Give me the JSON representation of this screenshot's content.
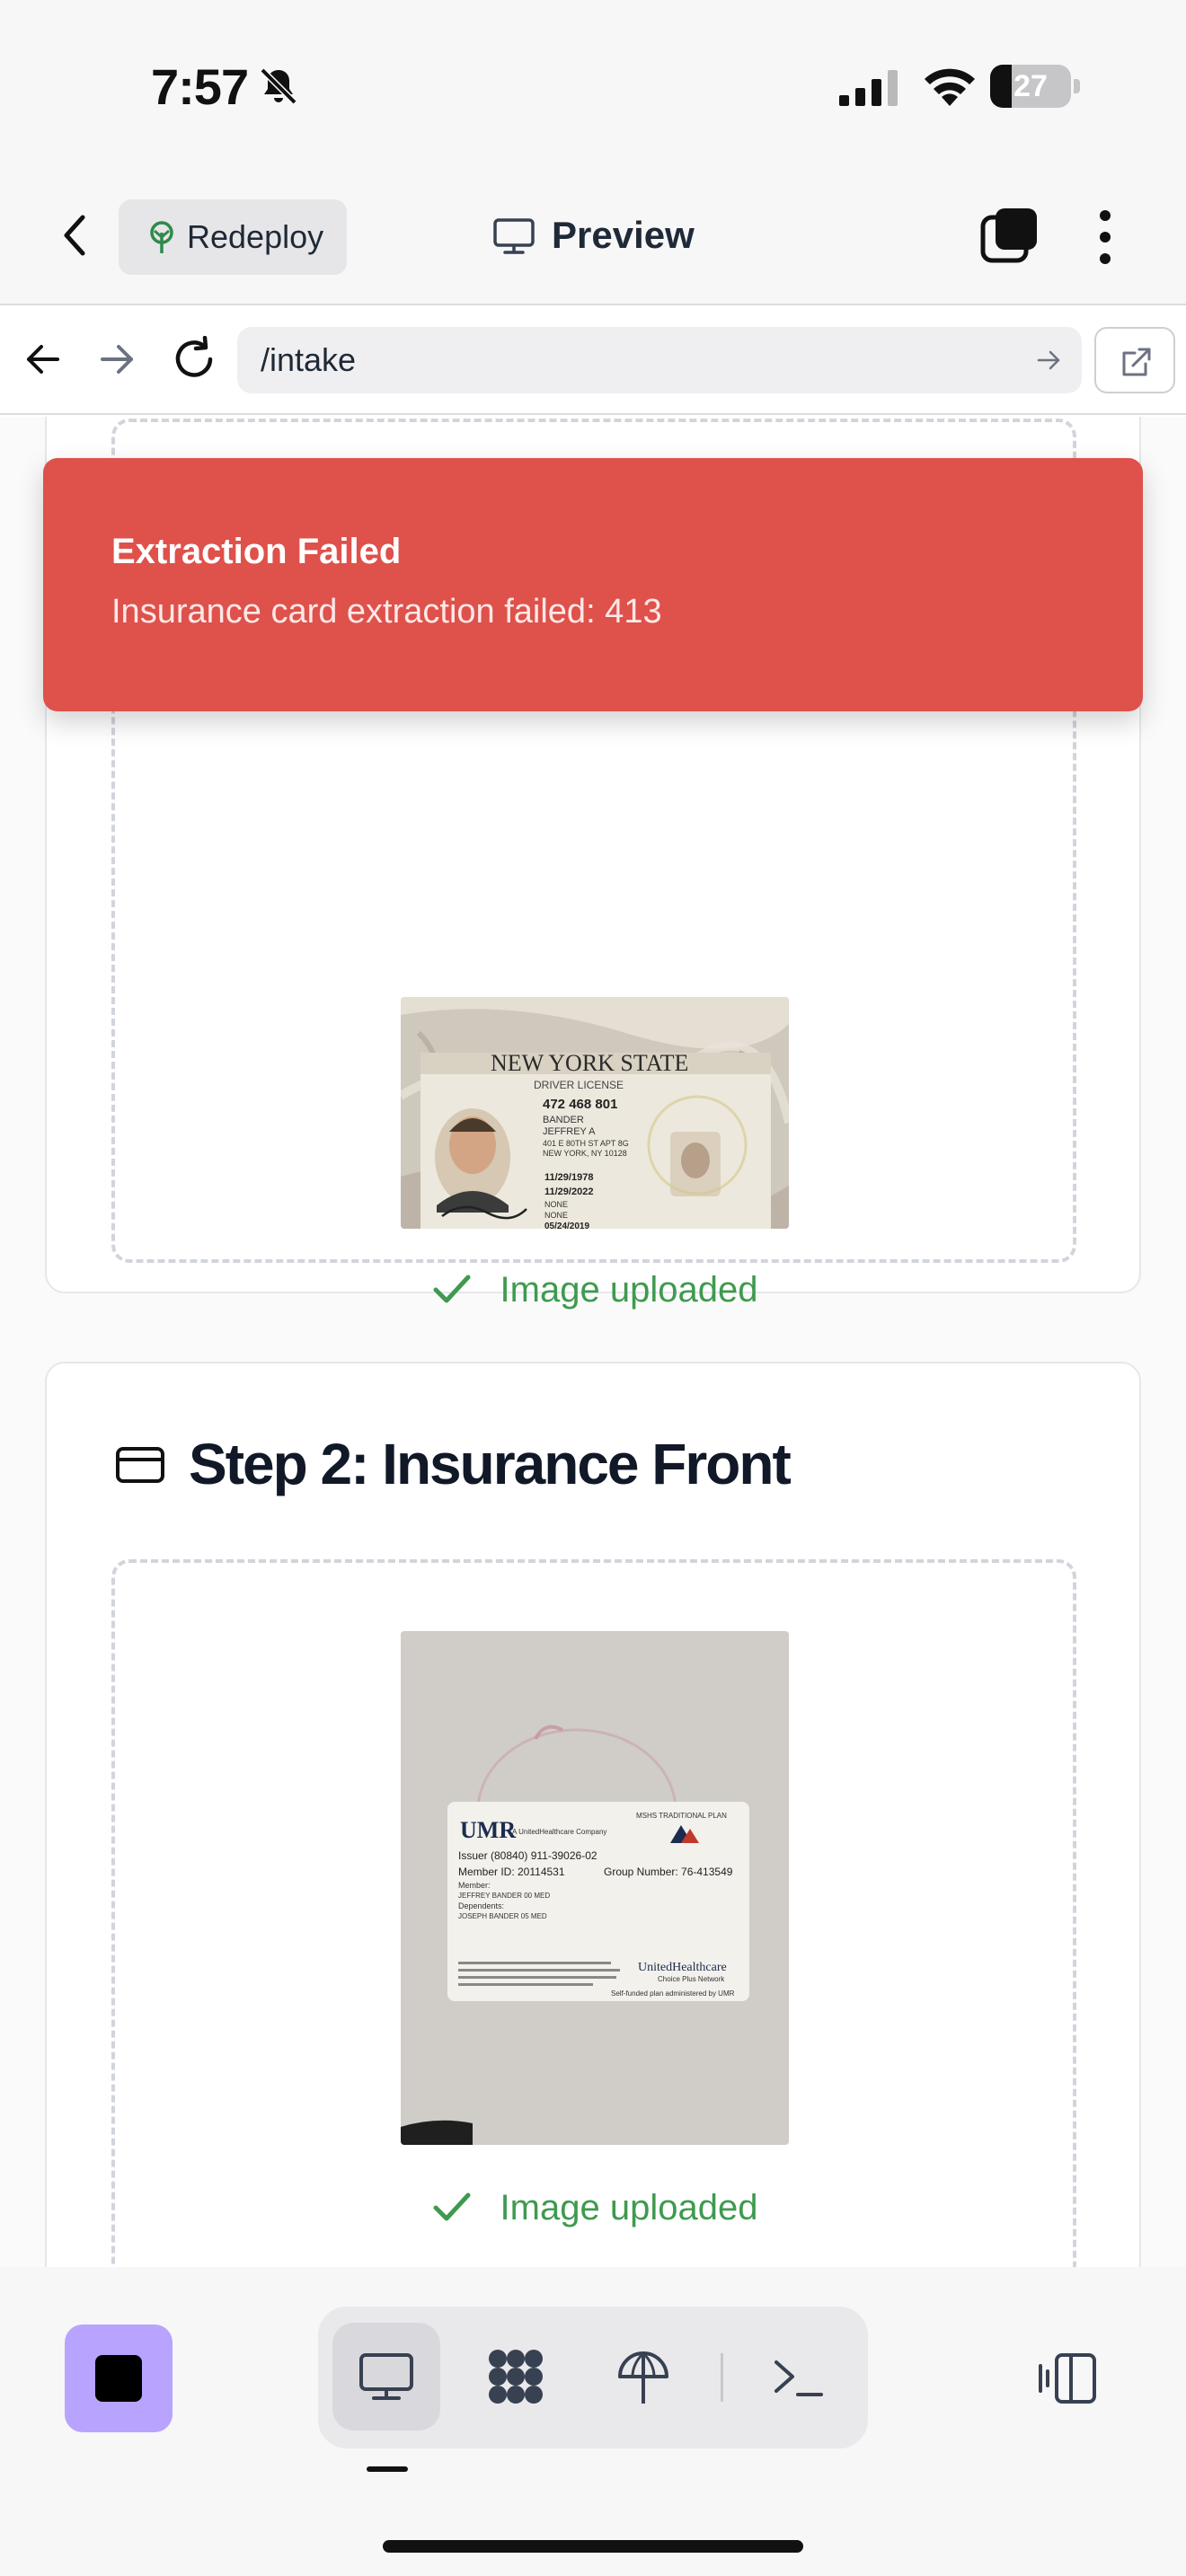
{
  "status_bar": {
    "time": "7:57",
    "battery_level": "27",
    "battery_fraction": 0.27,
    "icons": [
      "bell-slash-icon",
      "cellular-signal-icon",
      "wifi-icon",
      "battery-icon"
    ]
  },
  "header": {
    "back_icon": "chevron-left-icon",
    "redeploy_label": "Redeploy",
    "redeploy_icon": "deploy-tree-icon",
    "preview_label": "Preview",
    "preview_icon": "monitor-icon",
    "tabs_icon": "tabs-icon",
    "more_icon": "more-vertical-icon"
  },
  "browser": {
    "url": "/intake",
    "icons": [
      "arrow-left-icon",
      "arrow-right-icon",
      "reload-icon",
      "arrow-right-small-icon",
      "external-link-icon"
    ]
  },
  "toast": {
    "title": "Extraction Failed",
    "message": "Insurance card extraction failed: 413",
    "color": "#df514b"
  },
  "steps": [
    {
      "status": "Image uploaded",
      "image_alt": "Driver license photo"
    },
    {
      "title": "Step 2: Insurance Front",
      "icon": "credit-card-icon",
      "status": "Image uploaded",
      "image_alt": "Insurance card photo"
    }
  ],
  "license_card": {
    "state": "NEW YORK STATE",
    "type": "DRIVER LICENSE",
    "id": "472 468 801",
    "surname": "BANDER",
    "given": "JEFFREY A",
    "address_1": "401 E 80TH ST APT 8G",
    "address_2": "NEW YORK, NY 10128",
    "dob": "11/29/1978",
    "expires": "11/29/2022",
    "restr": "NONE",
    "endorse": "NONE",
    "issued": "05/24/2019"
  },
  "insurance_card": {
    "brand": "UMR",
    "tagline": "A UnitedHealthcare Company",
    "plan": "MSHS TRADITIONAL PLAN",
    "issuer": "Issuer (80840) 911-39026-02",
    "member_id": "Member ID: 20114531",
    "group_number": "Group Number: 76-413549",
    "member_label": "Member:",
    "member_name": "JEFFREY BANDER 00 MED",
    "dependents_label": "Dependents:",
    "dependent_name": "JOSEPH BANDER 05 MED",
    "network_brand": "UnitedHealthcare",
    "network": "Choice Plus Network",
    "footer": "Self-funded plan administered by UMR"
  },
  "toolbar": {
    "accent": "#b8a3ff",
    "items": [
      "desktop-icon",
      "grid-icon",
      "deploy-icon",
      "terminal-icon"
    ],
    "active": "desktop-icon",
    "panel_icon": "panel-toggle-icon"
  }
}
